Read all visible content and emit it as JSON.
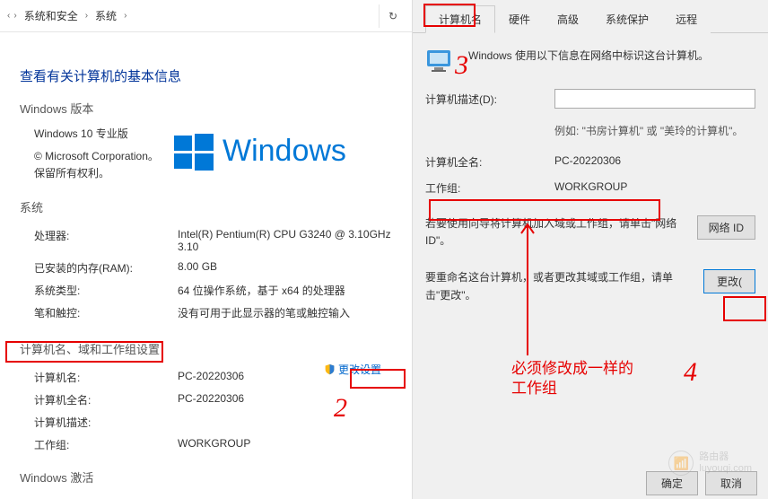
{
  "left": {
    "breadcrumb": {
      "item1": "系统和安全",
      "item2": "系统",
      "chev": "›",
      "refresh_icon": "↻"
    },
    "section_title": "查看有关计算机的基本信息",
    "winver_heading": "Windows 版本",
    "edition": "Windows 10 专业版",
    "copyright": "© Microsoft Corporation。保留所有权利。",
    "winword": "Windows ",
    "system": {
      "heading": "系统",
      "cpu_k": "处理器:",
      "cpu_v": "Intel(R) Pentium(R) CPU G3240 @ 3.10GHz    3.10",
      "ram_k": "已安装的内存(RAM):",
      "ram_v": "8.00 GB",
      "type_k": "系统类型:",
      "type_v": "64 位操作系统，基于 x64 的处理器",
      "pen_k": "笔和触控:",
      "pen_v": "没有可用于此显示器的笔或触控输入"
    },
    "namegroup": {
      "heading": "计算机名、域和工作组设置",
      "name_k": "计算机名:",
      "name_v": "PC-20220306",
      "full_k": "计算机全名:",
      "full_v": "PC-20220306",
      "desc_k": "计算机描述:",
      "desc_v": "",
      "wg_k": "工作组:",
      "wg_v": "WORKGROUP",
      "change_label": "更改设置"
    },
    "activation_heading": "Windows 激活"
  },
  "right": {
    "tabs": {
      "t1": "计算机名",
      "t2": "硬件",
      "t3": "高级",
      "t4": "系统保护",
      "t5": "远程"
    },
    "info_text": "Windows 使用以下信息在网络中标识这台计算机。",
    "desc_label": "计算机描述(D):",
    "desc_example": "例如: \"书房计算机\" 或 \"美玲的计算机\"。",
    "full_k": "计算机全名:",
    "full_v": "PC-20220306",
    "wg_k": "工作组:",
    "wg_v": "WORKGROUP",
    "network_text": "若要使用向导将计算机加入域或工作组，请单击\"网络 ID\"。",
    "network_btn": "网络 ID",
    "rename_text": "要重命名这台计算机，或者更改其域或工作组，请单击\"更改\"。",
    "rename_btn": "更改(",
    "ok_btn": "确定",
    "cancel_btn": "取消"
  },
  "annotations": {
    "num2": "2",
    "num3": "3",
    "num4": "4",
    "note": "必须修改成一样的工作组"
  },
  "watermark": {
    "brand": "路由器",
    "url": "luyouqi.com"
  }
}
